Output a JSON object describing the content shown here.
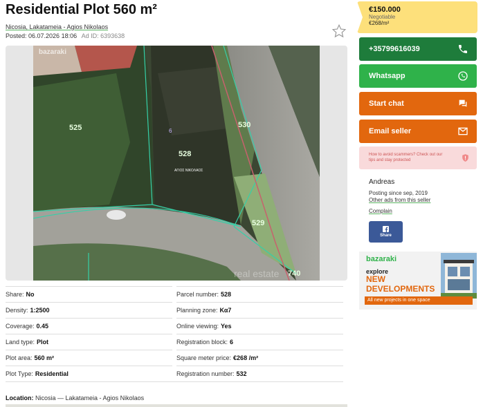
{
  "listing": {
    "title": "Residential Plot 560 m²",
    "location_link": "Nicosia, Lakatameia - Agios Nikolaos",
    "posted": "Posted: 06.07.2026 18:06",
    "ad_id": "Ad ID: 6393638"
  },
  "photo": {
    "watermark_brand": "bazaraki",
    "parcel_labels": [
      "525",
      "530",
      "528",
      "529",
      "740",
      "6"
    ],
    "overlay_text": "ΑΓΙΟΣ ΝΙΚΟΛΑΟΣ",
    "corner_watermark": "real estate"
  },
  "details": [
    {
      "label": "Share:",
      "value": "No",
      "label2": "Parcel number:",
      "value2": "528"
    },
    {
      "label": "Density:",
      "value": "1:2500",
      "label2": "Planning zone:",
      "value2": "Κα7"
    },
    {
      "label": "Coverage:",
      "value": "0.45",
      "label2": "Online viewing:",
      "value2": "Yes"
    },
    {
      "label": "Land type:",
      "value": "Plot",
      "label2": "Registration block:",
      "value2": "6"
    },
    {
      "label": "Plot area:",
      "value": "560 m²",
      "label2": "Square meter price:",
      "value2": "€268 /m²"
    },
    {
      "label": "Plot Type:",
      "value": "Residential",
      "label2": "Registration number:",
      "value2": "532"
    }
  ],
  "location": {
    "label": "Location:",
    "value": "Nicosia — Lakatameia - Agios Nikolaos"
  },
  "price": {
    "amount": "€150.000",
    "negotiable": "Negotiable",
    "per_sqm": "€268/m²"
  },
  "contact": {
    "phone": "+35799616039",
    "whatsapp": "Whatsapp",
    "chat": "Start chat",
    "email": "Email seller"
  },
  "scam_notice": "How to avoid scammers? Check out our tips and stay protected",
  "seller": {
    "name": "Andreas",
    "since": "Posting since sep, 2019",
    "other_ads": "Other ads from this seller",
    "complain": "Complain",
    "share": "Share"
  },
  "banner": {
    "logo": "bazaraki",
    "explore": "explore",
    "headline": "NEW DEVELOPMENTS",
    "strip": "All new projects in one space"
  },
  "colors": {
    "phone_button": "#1e7c3b",
    "whatsapp_button": "#2fb24a",
    "orange_button": "#e2670e",
    "price_bg": "#fde07b",
    "scam_bg": "#f9dadb"
  }
}
